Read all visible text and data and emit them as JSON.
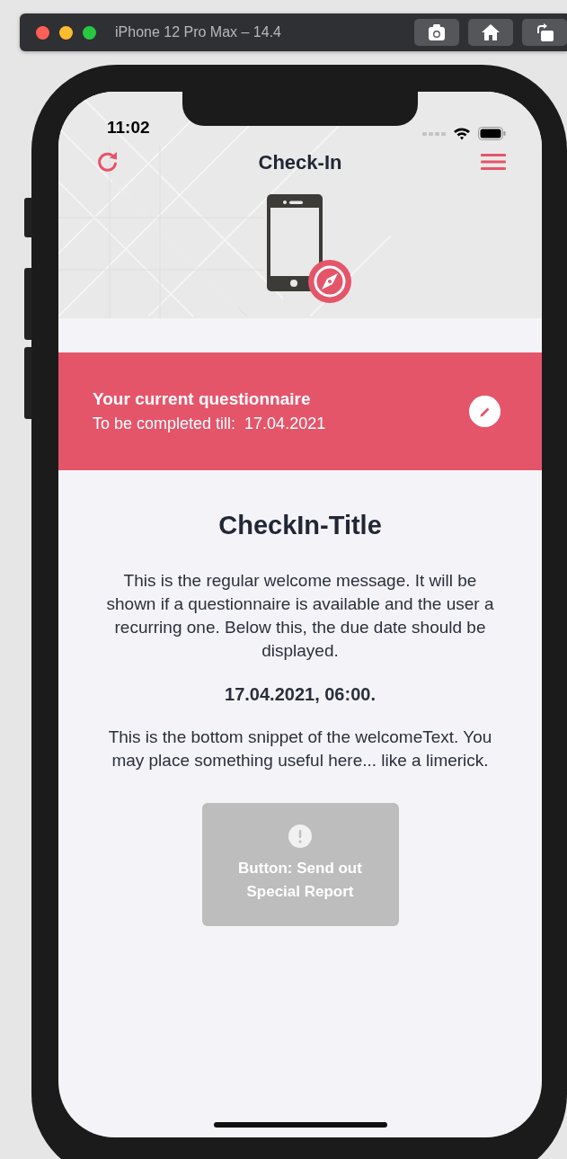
{
  "simulator": {
    "title": "iPhone 12 Pro Max – 14.4"
  },
  "status_bar": {
    "time": "11:02"
  },
  "nav": {
    "title": "Check-In"
  },
  "banner": {
    "title": "Your current questionnaire",
    "subtitle": "To be completed till:  17.04.2021"
  },
  "content": {
    "title": "CheckIn-Title",
    "message": "This is the regular welcome message. It will be shown if a questionnaire is available and the user a recurring one. Below this, the due date should be displayed.",
    "due": "17.04.2021, 06:00.",
    "footer": "This is the bottom snippet of the welcomeText. You may place something useful here... like a limerick."
  },
  "action_button": {
    "label": "Button: Send out Special Report",
    "disabled": true
  }
}
